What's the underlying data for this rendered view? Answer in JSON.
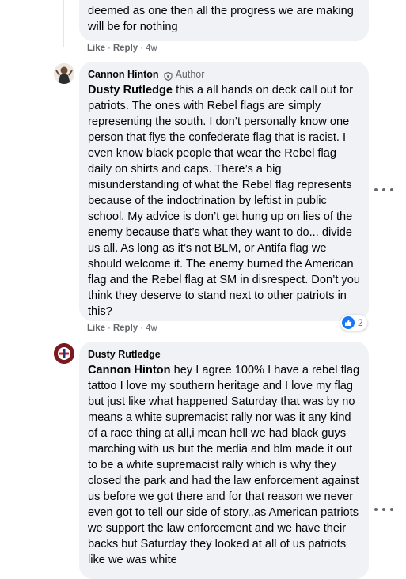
{
  "comment0": {
    "text_tail": "deemed as one then all the progress we are making will be for nothing",
    "like": "Like",
    "reply": "Reply",
    "time": "4w"
  },
  "comment1": {
    "author": "Cannon Hinton",
    "author_tag": "Author",
    "mention": "Dusty Rutledge",
    "text": " this a all hands on deck call out for patriots. The ones with Rebel flags are simply representing the south. I don’t personally know one person that flys the confederate flag that is racist. I even know black people that wear the Rebel flag daily on shirts and caps. There’s a big misunderstanding of what the Rebel flag represents because of the indoctrination by leftist in public school. My advice is don’t get hung up on lies of the enemy because that’s what they want to do... divide us all. As long as it’s not BLM, or Antifa flag we should welcome it. The enemy burned the American flag and the Rebel flag at SM in disrespect. Don’t you think they deserve to stand next to other patriots in this?",
    "like": "Like",
    "reply": "Reply",
    "time": "4w",
    "reaction_count": "2"
  },
  "comment2": {
    "author": "Dusty Rutledge",
    "mention": "Cannon Hinton",
    "text": " hey I agree 100% I have a rebel flag tattoo I love my southern heritage and I love my flag but just like what happened Saturday that was by no means a white supremacist rally nor was it any kind of a race thing at all,i mean hell we had black guys marching with us but the media and blm made it out to be a white supremacist rally which is why they closed the park and had the law enforcement against us before we got there and for that reason we never even got to tell our side of story..as American patriots we support the law enforcement and we have their backs but Saturday they looked at all of us patriots like we was white"
  },
  "icons": {
    "badge": "shield-badge-icon",
    "like": "thumbs-up-icon",
    "more": "more-options-icon"
  },
  "colors": {
    "bubble": "#f0f2f5",
    "meta": "#65676b",
    "like_blue": "#1877f2"
  }
}
